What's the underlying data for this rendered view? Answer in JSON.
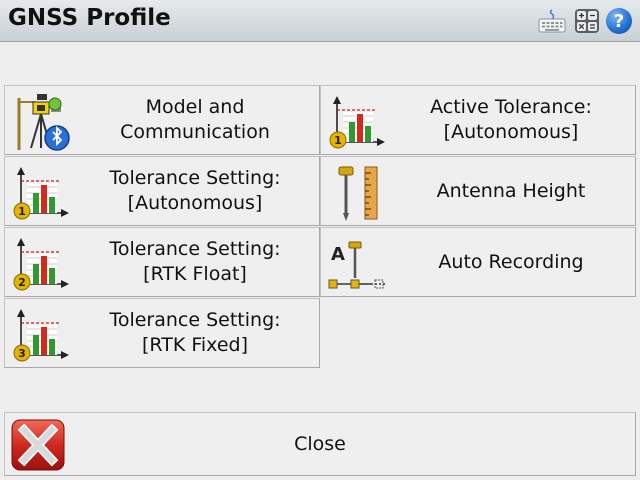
{
  "window": {
    "title": "GNSS Profile"
  },
  "toolbar": {
    "icons": [
      "keyboard-icon",
      "calculator-icon",
      "help-icon"
    ],
    "help_glyph": "?"
  },
  "buttons": {
    "model": {
      "line1": "Model and",
      "line2": "Communication",
      "icon": "receiver-bluetooth-icon"
    },
    "active_tolerance": {
      "line1": "Active Tolerance:",
      "line2": "[Autonomous]",
      "icon": "tolerance-chart-icon",
      "badge": "1"
    },
    "tol_autonomous": {
      "line1": "Tolerance Setting:",
      "line2": "[Autonomous]",
      "icon": "tolerance-chart-icon",
      "badge": "1"
    },
    "antenna_height": {
      "line1": "Antenna Height",
      "icon": "antenna-height-icon"
    },
    "tol_rtk_float": {
      "line1": "Tolerance Setting:",
      "line2": "[RTK Float]",
      "icon": "tolerance-chart-icon",
      "badge": "2"
    },
    "auto_recording": {
      "line1": "Auto Recording",
      "icon": "auto-recording-icon",
      "icon_letter": "A"
    },
    "tol_rtk_fixed": {
      "line1": "Tolerance Setting:",
      "line2": "[RTK Fixed]",
      "icon": "tolerance-chart-icon",
      "badge": "3"
    }
  },
  "footer": {
    "close_label": "Close",
    "icon": "close-x-icon"
  },
  "colors": {
    "accent_red": "#c8201c",
    "badge_gold": "#e6b400",
    "bar_red": "#d42a1e",
    "bar_green": "#2f9a2f",
    "help_blue": "#1f6fd0"
  }
}
